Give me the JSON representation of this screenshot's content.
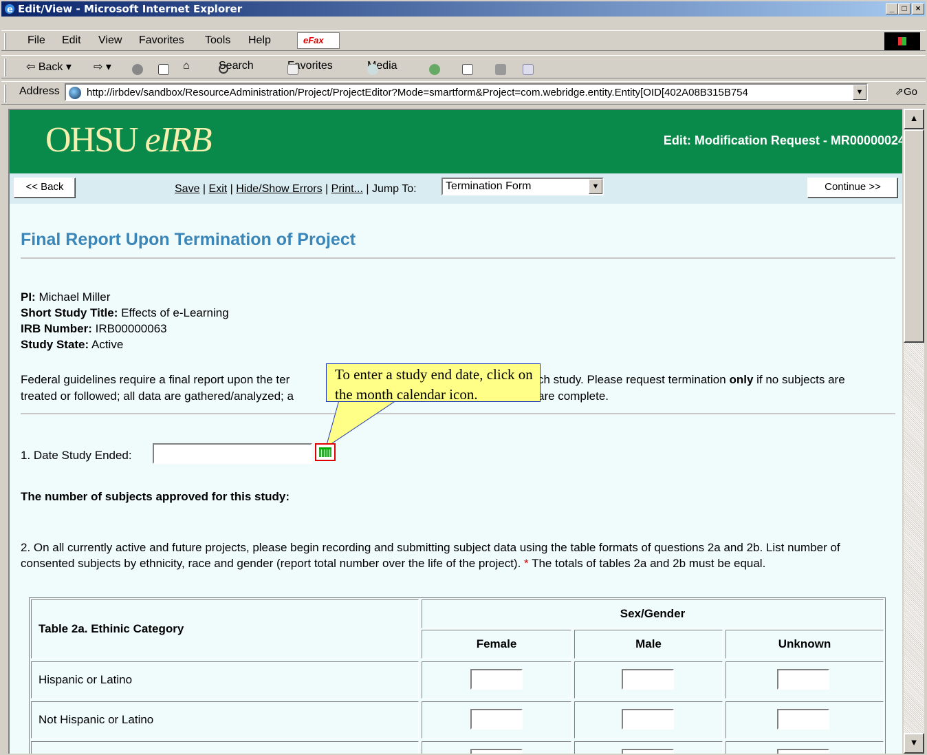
{
  "window": {
    "title": "Edit/View - Microsoft Internet Explorer",
    "controls": [
      "_",
      "□",
      "×"
    ]
  },
  "menubar": {
    "items": [
      "File",
      "Edit",
      "View",
      "Favorites",
      "Tools",
      "Help"
    ],
    "efax": "eFax"
  },
  "toolbar": {
    "back": "Back",
    "search": "Search",
    "favorites": "Favorites",
    "media": "Media"
  },
  "addressbar": {
    "label": "Address",
    "url": "http://irbdev/sandbox/ResourceAdministration/Project/ProjectEditor?Mode=smartform&Project=com.webridge.entity.Entity[OID[402A08B315B754",
    "go": "Go"
  },
  "banner": {
    "logo_main": "OHSU",
    "logo_italic": "eIRB",
    "edit_title": "Edit: Modification Request - MR00000024"
  },
  "nav": {
    "back_button": "<< Back",
    "save": "Save",
    "exit": "Exit",
    "hide_show_errors": "Hide/Show Errors",
    "print": "Print...",
    "jump_to_label": "Jump To:",
    "jump_to_value": "Termination Form",
    "continue_button": "Continue >>"
  },
  "page": {
    "title": "Final Report Upon Termination of Project",
    "pi_label": "PI:",
    "pi_value": "Michael  Miller",
    "short_title_label": "Short Study Title:",
    "short_title_value": "Effects of e-Learning",
    "irb_label": "IRB Number:",
    "irb_value": "IRB00000063",
    "state_label": "Study State:",
    "state_value": "Active",
    "federal_line1_a": "Federal guidelines require a final report upon the ter",
    "federal_line1_b": "ch study.  Please request termination ",
    "federal_line1_bold": "only",
    "federal_line1_c": " if no subjects are",
    "federal_line2_a": "treated or followed; all data are gathered/analyzed; a",
    "federal_line2_b": " are complete.",
    "callout_text": "To enter a study end date, click on the month calendar icon.",
    "q1_label": "1.  Date Study Ended:",
    "subjects_heading": "The number of subjects approved for this study:",
    "q2_text": "2. On all currently active and future projects, please begin recording and submitting subject data using the table formats of questions 2a and 2b.  List number of consented subjects by ethnicity, race and gender (report total number over the life of the project).",
    "q2_asterisk": "*",
    "q2_tail": " The totals of tables 2a and 2b must be equal."
  },
  "table2a": {
    "title": "Table 2a.  Ethinic Category",
    "group_header": "Sex/Gender",
    "columns": [
      "Female",
      "Male",
      "Unknown"
    ],
    "rows": [
      "Hispanic or Latino",
      "Not Hispanic or Latino"
    ]
  }
}
